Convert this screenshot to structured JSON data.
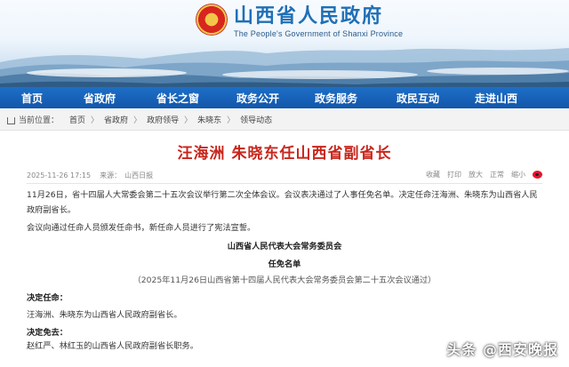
{
  "header": {
    "title": "山西省人民政府",
    "subtitle": "The People's Government of Shanxi Province"
  },
  "nav": {
    "items": [
      "首页",
      "省政府",
      "省长之窗",
      "政务公开",
      "政务服务",
      "政民互动",
      "走进山西"
    ]
  },
  "breadcrumb": {
    "prefix": "当前位置：",
    "items": [
      "首页",
      "省政府",
      "政府领导",
      "朱晓东",
      "领导动态"
    ]
  },
  "article": {
    "title": "汪海洲 朱晓东任山西省副省长",
    "date": "2025-11-26 17:15",
    "source_label": "来源：",
    "source": "山西日报",
    "tools": [
      "收藏",
      "打印",
      "放大",
      "正常",
      "缩小"
    ],
    "paragraphs": [
      "11月26日，省十四届人大常委会第二十五次会议举行第二次全体会议。会议表决通过了人事任免名单。决定任命汪海洲、朱晓东为山西省人民政府副省长。",
      "会议向通过任命人员颁发任命书，新任命人员进行了宪法宣誓。"
    ],
    "org": "山西省人民代表大会常务委员会",
    "list_name": "任免名单",
    "passed_note": "（2025年11月26日山西省第十四届人民代表大会常务委员会第二十五次会议通过）",
    "appoint_label": "决定任命：",
    "appoint_text": "汪海洲、朱晓东为山西省人民政府副省长。",
    "dismiss_label": "决定免去：",
    "dismiss_text": "赵红严、林红玉的山西省人民政府副省长职务。"
  },
  "watermark": "头条 @西安晚报",
  "colors": {
    "nav": "#1257aa",
    "title_red": "#c8261c",
    "brand_blue": "#1f6fb6"
  }
}
